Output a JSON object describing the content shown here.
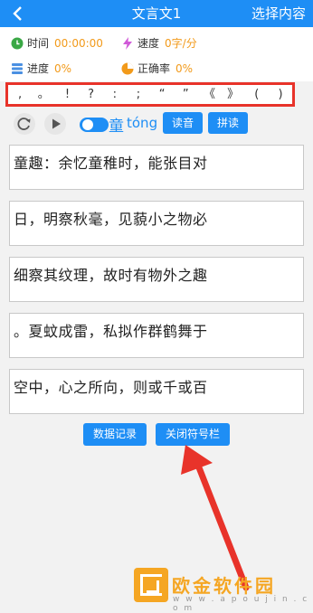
{
  "header": {
    "title": "文言文1",
    "action": "选择内容"
  },
  "stats": {
    "time": {
      "label": "时间",
      "value": "00:00:00"
    },
    "speed": {
      "label": "速度",
      "value": "0字/分"
    },
    "progress": {
      "label": "进度",
      "value": "0%"
    },
    "accuracy": {
      "label": "正确率",
      "value": "0%"
    }
  },
  "punctuation": [
    ",",
    "。",
    "!",
    "?",
    ":",
    ";",
    "“",
    "”",
    "《",
    "》",
    "(",
    ")"
  ],
  "controls": {
    "char": "童",
    "pinyin": "tóng",
    "read_label": "读音",
    "spell_label": "拼读"
  },
  "lines": [
    "童趣：余忆童稚时，能张目对",
    "日，明察秋毫，见藐小之物必",
    "细察其纹理，故时有物外之趣",
    "。夏蚊成雷，私拟作群鹤舞于",
    "空中，心之所向，则或千或百"
  ],
  "footer": {
    "records_label": "数据记录",
    "close_label": "关闭符号栏"
  },
  "watermark": {
    "name": "欧金软件园",
    "url": "w w w . a p o u j i n . c o m"
  },
  "colors": {
    "accent": "#1e8ef5",
    "highlight": "#e8332a",
    "value": "#f29a1a"
  }
}
